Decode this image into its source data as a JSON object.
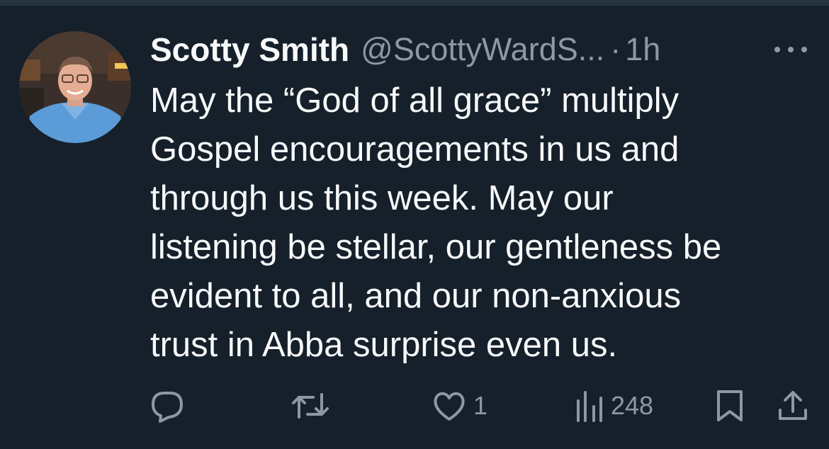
{
  "tweet": {
    "display_name": "Scotty Smith",
    "handle": "@ScottyWardS...",
    "separator": "·",
    "time": "1h",
    "text": "May the “God of all grace” multiply\nGospel encouragements in us and\nthrough us this week. May our\nlistening be stellar, our gentleness be\nevident to all, and our non-anxious\ntrust in Abba surprise even us."
  },
  "actions": {
    "reply_count": "",
    "retweet_count": "",
    "like_count": "1",
    "view_count": "248"
  },
  "colors": {
    "background": "#15202b",
    "primary_text": "#f7f9f9",
    "secondary_text": "#8b98a5"
  },
  "icons": {
    "reply": "reply-icon",
    "retweet": "retweet-icon",
    "like": "heart-icon",
    "views": "views-icon",
    "bookmark": "bookmark-icon",
    "share": "share-icon",
    "more": "more-icon"
  }
}
